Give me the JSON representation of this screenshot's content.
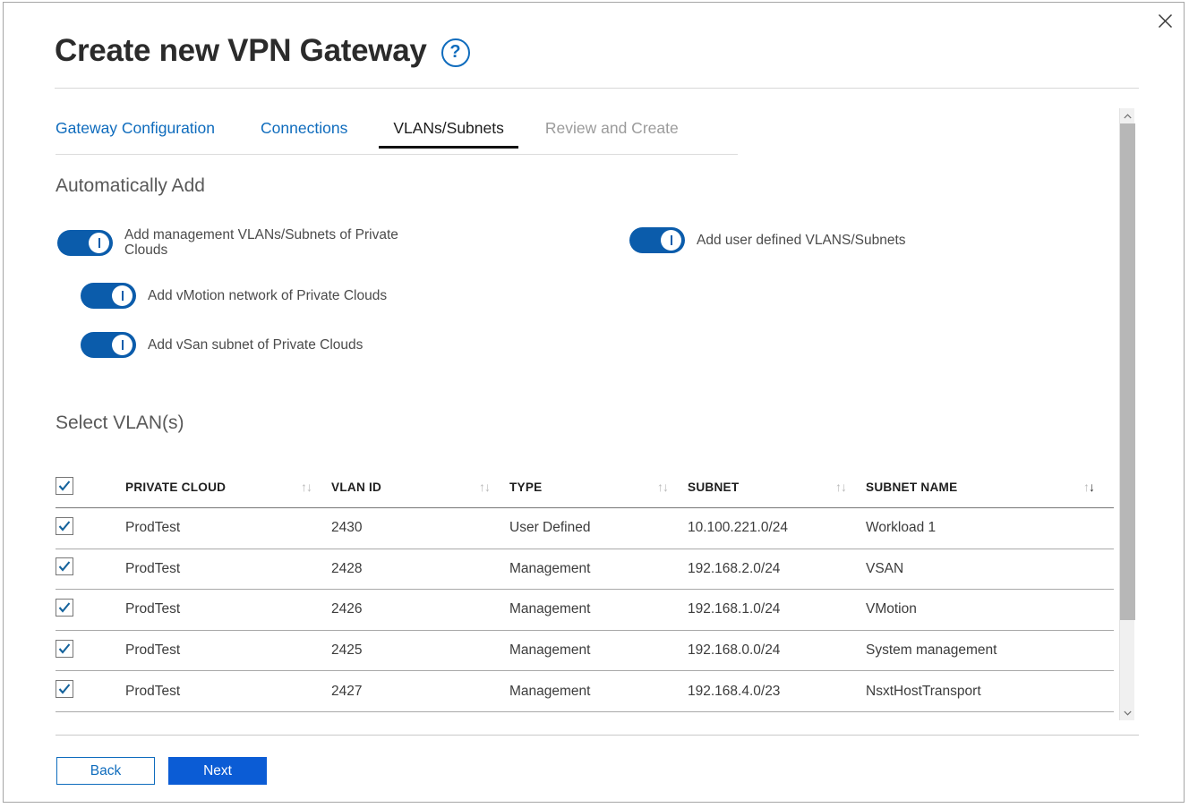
{
  "dialog": {
    "title": "Create new VPN Gateway",
    "help_icon_label": "?",
    "close_label": "×"
  },
  "tabs": [
    {
      "label": "Gateway Configuration",
      "state": "link"
    },
    {
      "label": "Connections",
      "state": "link"
    },
    {
      "label": "VLANs/Subnets",
      "state": "active"
    },
    {
      "label": "Review and Create",
      "state": "disabled"
    }
  ],
  "sections": {
    "auto_add_title": "Automatically Add",
    "select_vlan_title": "Select VLAN(s)"
  },
  "toggles": [
    {
      "id": "mgmt",
      "label": "Add management VLANs/Subnets of Private Clouds",
      "on": true
    },
    {
      "id": "user",
      "label": "Add user defined VLANS/Subnets",
      "on": true
    },
    {
      "id": "vmotion",
      "label": "Add vMotion network of Private Clouds",
      "on": true
    },
    {
      "id": "vsan",
      "label": "Add vSan subnet of Private Clouds",
      "on": true
    }
  ],
  "table": {
    "select_all_checked": true,
    "columns": [
      {
        "key": "private_cloud",
        "label": "PRIVATE CLOUD",
        "sortable": true,
        "sort": "none"
      },
      {
        "key": "vlan_id",
        "label": "VLAN ID",
        "sortable": true,
        "sort": "none"
      },
      {
        "key": "type",
        "label": "TYPE",
        "sortable": true,
        "sort": "none"
      },
      {
        "key": "subnet",
        "label": "SUBNET",
        "sortable": true,
        "sort": "none"
      },
      {
        "key": "subnet_name",
        "label": "SUBNET NAME",
        "sortable": true,
        "sort": "desc"
      }
    ],
    "rows": [
      {
        "checked": true,
        "private_cloud": "ProdTest",
        "vlan_id": "2430",
        "type": "User Defined",
        "subnet": "10.100.221.0/24",
        "subnet_name": "Workload 1"
      },
      {
        "checked": true,
        "private_cloud": "ProdTest",
        "vlan_id": "2428",
        "type": "Management",
        "subnet": "192.168.2.0/24",
        "subnet_name": "VSAN"
      },
      {
        "checked": true,
        "private_cloud": "ProdTest",
        "vlan_id": "2426",
        "type": "Management",
        "subnet": "192.168.1.0/24",
        "subnet_name": "VMotion"
      },
      {
        "checked": true,
        "private_cloud": "ProdTest",
        "vlan_id": "2425",
        "type": "Management",
        "subnet": "192.168.0.0/24",
        "subnet_name": "System management"
      },
      {
        "checked": true,
        "private_cloud": "ProdTest",
        "vlan_id": "2427",
        "type": "Management",
        "subnet": "192.168.4.0/23",
        "subnet_name": "NsxtHostTransport"
      },
      {
        "checked": true,
        "private_cloud": "",
        "vlan_id": "",
        "type": "",
        "subnet": "",
        "subnet_name": "",
        "partial": true
      }
    ]
  },
  "footer": {
    "back_label": "Back",
    "next_label": "Next"
  },
  "colors": {
    "accent_blue": "#0f6cbd",
    "toggle_blue": "#0b5cab",
    "primary_button": "#0b5cd5",
    "text": "#3c3c3c",
    "muted": "#9b9b9b"
  }
}
